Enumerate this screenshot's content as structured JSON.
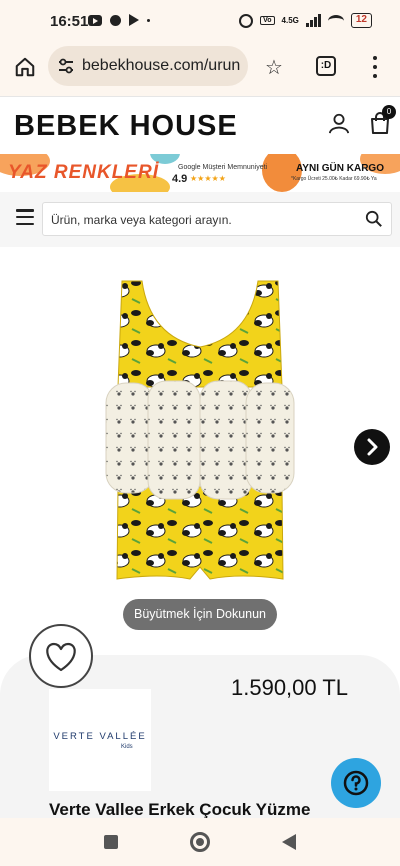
{
  "status_bar": {
    "time": "16:51",
    "network": "4.5G",
    "battery": "12"
  },
  "browser": {
    "url": "bebekhouse.com/urun"
  },
  "site": {
    "logo": "BEBEK HOUSE",
    "cart_count": "0",
    "banner": {
      "headline": "YAZ RENKLERİ",
      "google_message": "Google Müşteri Memnuniyeti",
      "rating": "4.9",
      "stars": "★★★★★",
      "cargo": "AYNI GÜN KARGO",
      "cargo_note": "*Kargo Ücreti 25.00₺ Kadar 69.90₺ Ya"
    },
    "search": {
      "placeholder": "Ürün, marka veya kategori arayın."
    }
  },
  "product": {
    "zoom_hint": "Büyütmek İçin Dokunun",
    "price": "1.590,00 TL",
    "brand_name": "VERTE VALLÉE",
    "brand_sub": "Kids",
    "title": "Verte Vallee Erkek Çocuk Yüzme"
  },
  "icons": {
    "home": "home-icon",
    "tune": "tune-icon",
    "star": "star-outline-icon",
    "tabs": "tabs-icon",
    "menu": "more-vert-icon",
    "user": "user-icon",
    "cart": "cart-icon",
    "hamburger": "menu-icon",
    "search": "search-icon",
    "next": "chevron-right-icon",
    "heart": "heart-outline-icon",
    "help": "help-icon"
  },
  "colors": {
    "banner_accent": "#e8562a",
    "help_button": "#2ea4e0",
    "pill": "#707070",
    "vest_yellow": "#f2d31b"
  }
}
